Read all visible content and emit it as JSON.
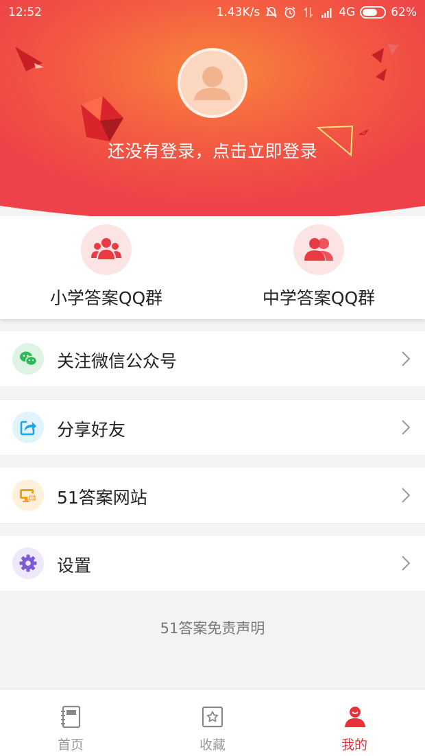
{
  "status_bar": {
    "time": "12:52",
    "speed": "1.43K/s",
    "network": "4G",
    "battery": "62%"
  },
  "header": {
    "login_prompt": "还没有登录，点击立即登录",
    "gradient_center": "#f9863c",
    "gradient_edge": "#ef4349"
  },
  "groups": [
    {
      "label": "小学答案QQ群",
      "icon": "group-icon"
    },
    {
      "label": "中学答案QQ群",
      "icon": "group-icon"
    }
  ],
  "menu": [
    {
      "label": "关注微信公众号",
      "icon": "wechat-icon",
      "icon_color": "#3cb371",
      "icon_bg": "#dff3e4"
    },
    {
      "label": "分享好友",
      "icon": "share-icon",
      "icon_color": "#1aa7e8",
      "icon_bg": "#e1f3fc"
    },
    {
      "label": "51答案网站",
      "icon": "website-icon",
      "icon_color": "#f0a020",
      "icon_bg": "#fdf1dc"
    },
    {
      "label": "设置",
      "icon": "settings-icon",
      "icon_color": "#7d5bd6",
      "icon_bg": "#eee8fb"
    }
  ],
  "disclaimer": "51答案免责声明",
  "bottom_nav": [
    {
      "label": "首页",
      "icon": "notebook-icon",
      "active": false
    },
    {
      "label": "收藏",
      "icon": "favorite-star-icon",
      "active": false
    },
    {
      "label": "我的",
      "icon": "profile-icon",
      "active": true
    }
  ],
  "accent_color": "#e8313a"
}
